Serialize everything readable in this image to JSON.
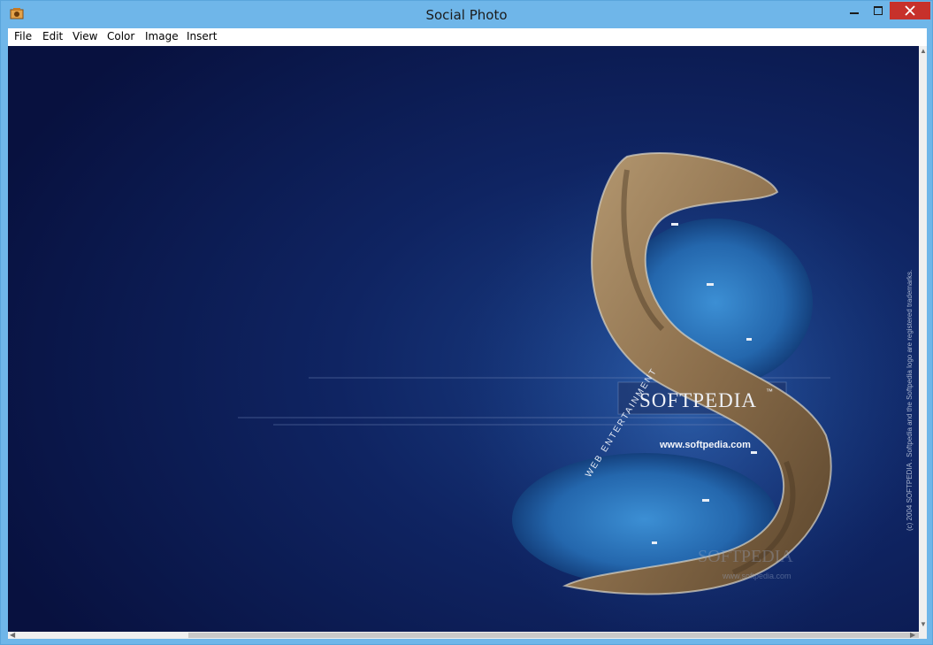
{
  "window": {
    "title": "Social Photo",
    "title_color": "#6fb6e9",
    "close_color": "#c7312b"
  },
  "menu": {
    "items": [
      "File",
      "Edit",
      "View",
      "Color",
      "Image",
      "Insert"
    ]
  },
  "image": {
    "brand": "SOFTPEDIA",
    "tm": "™",
    "url": "www.softpedia.com",
    "tagline": "WEB ENTERTAINMENT",
    "watermark": "SOFTPEDIA",
    "watermark_url": "www.softpedia.com",
    "copyright": "(c) 2004 SOFTPEDIA . Softpedia and the Softpedia logo are registered trademarks.",
    "background_color": "#0a1648"
  }
}
